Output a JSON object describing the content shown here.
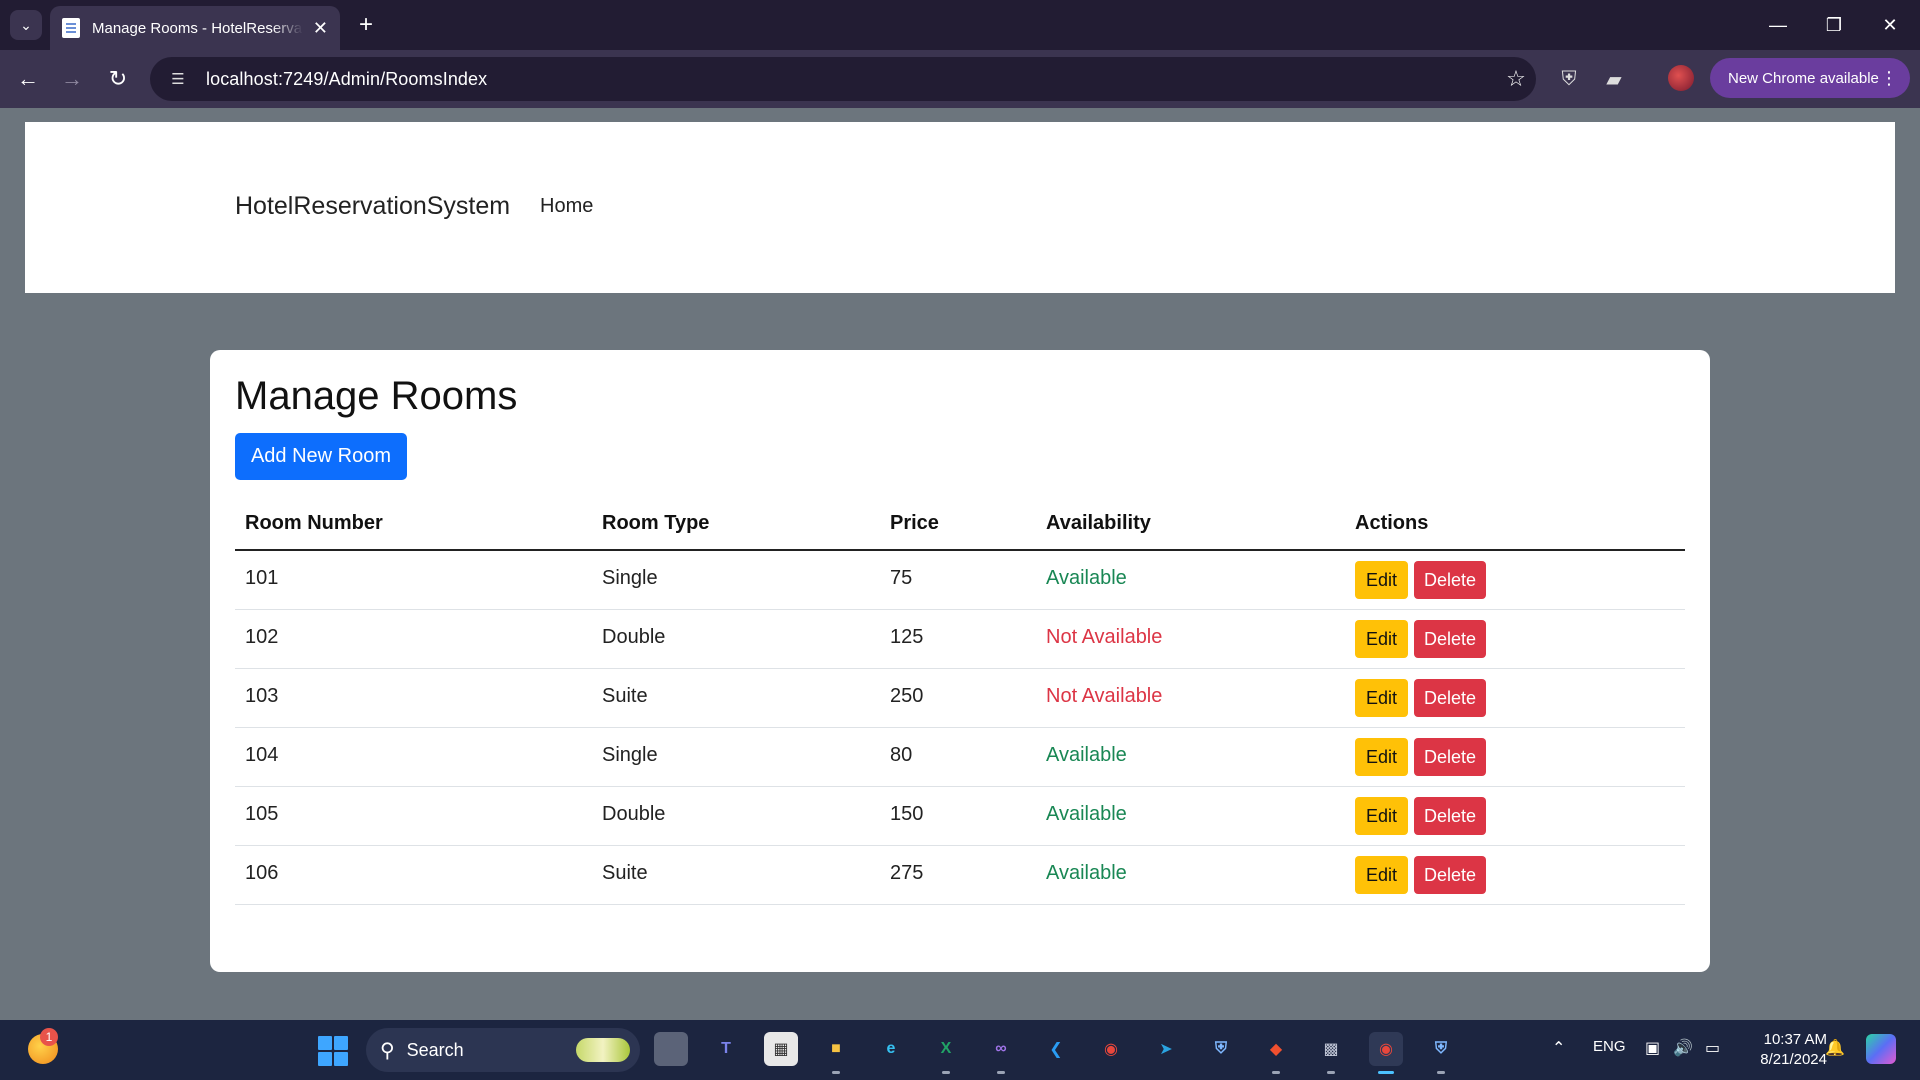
{
  "browser": {
    "tab_title": "Manage Rooms - HotelReservationSystem",
    "url": "localhost:7249/Admin/RoomsIndex",
    "new_chrome_label": "New Chrome available"
  },
  "site": {
    "brand": "HotelReservationSystem",
    "nav": {
      "home": "Home"
    }
  },
  "page": {
    "title": "Manage Rooms",
    "add_button": "Add New Room"
  },
  "table": {
    "headers": [
      "Room Number",
      "Room Type",
      "Price",
      "Availability",
      "Actions"
    ],
    "rows": [
      {
        "number": "101",
        "type": "Single",
        "price": "75",
        "availability": "Available",
        "available": true
      },
      {
        "number": "102",
        "type": "Double",
        "price": "125",
        "availability": "Not Available",
        "available": false
      },
      {
        "number": "103",
        "type": "Suite",
        "price": "250",
        "availability": "Not Available",
        "available": false
      },
      {
        "number": "104",
        "type": "Single",
        "price": "80",
        "availability": "Available",
        "available": true
      },
      {
        "number": "105",
        "type": "Double",
        "price": "150",
        "availability": "Available",
        "available": true
      },
      {
        "number": "106",
        "type": "Suite",
        "price": "275",
        "availability": "Available",
        "available": true
      }
    ],
    "edit_label": "Edit",
    "delete_label": "Delete"
  },
  "colors": {
    "primary": "#0d6efd",
    "warning": "#ffc107",
    "danger": "#dc3545",
    "success": "#198754",
    "page_background": "#6c757d"
  },
  "taskbar": {
    "search_label": "Search",
    "weather_badge": "1",
    "language": "ENG",
    "time": "10:37 AM",
    "date": "8/21/2024",
    "apps": [
      "file-explorer-icon",
      "teams-icon",
      "store-icon",
      "folder-icon",
      "edge-icon",
      "excel-icon",
      "visual-studio-icon",
      "vscode-icon",
      "chrome-icon",
      "telegram-icon",
      "shield-icon",
      "git-icon",
      "terminal-icon",
      "chrome-icon",
      "security-icon"
    ]
  }
}
